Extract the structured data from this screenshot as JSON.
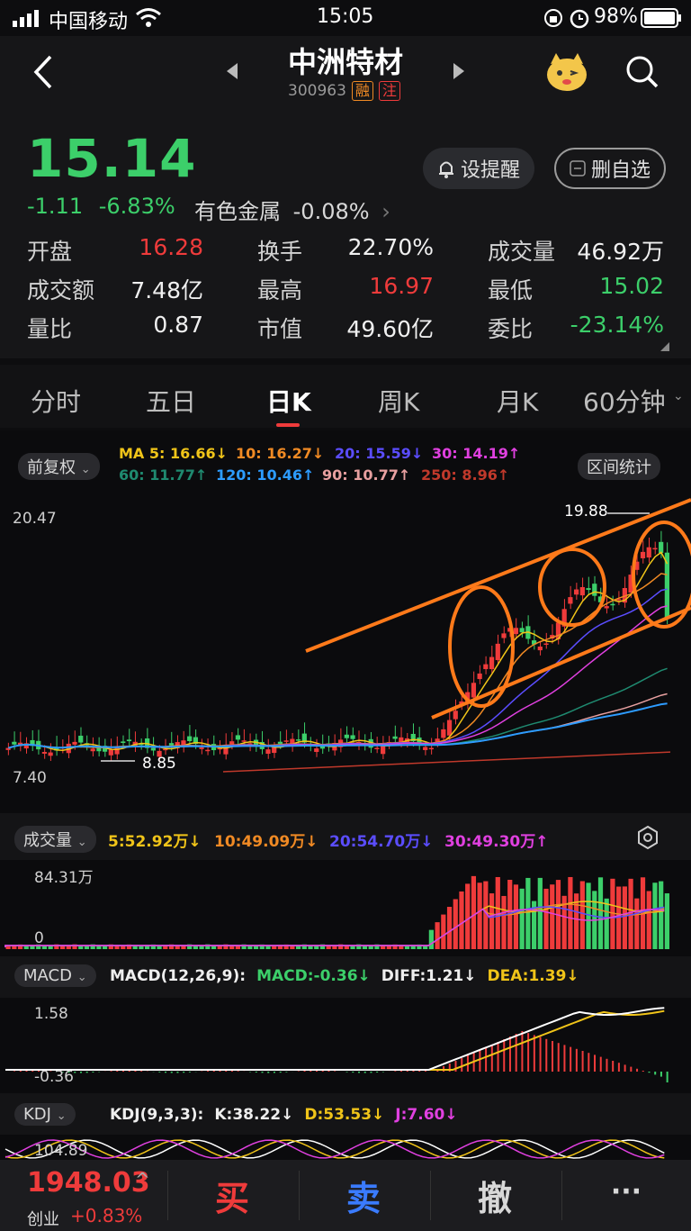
{
  "status_bar": {
    "carrier": "中国移动",
    "time": "15:05",
    "battery": "98%"
  },
  "header": {
    "name": "中洲特材",
    "code": "300963",
    "tag1": "融",
    "tag2": "注"
  },
  "quote": {
    "price": "15.14",
    "change": "-1.11",
    "change_pct": "-6.83%",
    "sector": "有色金属",
    "sector_pct": "-0.08%",
    "alert_label": "设提醒",
    "remove_label": "删自选",
    "stats": [
      {
        "label": "开盘",
        "value": "16.28",
        "color": "red"
      },
      {
        "label": "换手",
        "value": "22.70%",
        "color": "white"
      },
      {
        "label": "成交量",
        "value": "46.92万",
        "color": "white"
      },
      {
        "label": "成交额",
        "value": "7.48亿",
        "color": "white"
      },
      {
        "label": "最高",
        "value": "16.97",
        "color": "red"
      },
      {
        "label": "最低",
        "value": "15.02",
        "color": "green"
      },
      {
        "label": "量比",
        "value": "0.87",
        "color": "white"
      },
      {
        "label": "市值",
        "value": "49.60亿",
        "color": "white"
      },
      {
        "label": "委比",
        "value": "-23.14%",
        "color": "green"
      }
    ]
  },
  "tabs": [
    "分时",
    "五日",
    "日K",
    "周K",
    "月K",
    "60分钟"
  ],
  "active_tab": "日K",
  "kline": {
    "adjust_label": "前复权",
    "range_label": "区间统计",
    "ma": [
      {
        "label": "MA 5: 16.66↓",
        "color": "#f0c419"
      },
      {
        "label": "10: 16.27↓",
        "color": "#f08a24"
      },
      {
        "label": "20: 15.59↓",
        "color": "#5b4dff"
      },
      {
        "label": "30: 14.19↑",
        "color": "#e040e0"
      },
      {
        "label": "60: 11.77↑",
        "color": "#1f8a70"
      },
      {
        "label": "120: 10.46↑",
        "color": "#2d9cff"
      },
      {
        "label": "90: 10.77↑",
        "color": "#e8a0a0"
      },
      {
        "label": "250: 8.96↑",
        "color": "#c0392b"
      }
    ],
    "y_top": "20.47",
    "y_bottom": "7.40",
    "high_mark": "19.88",
    "low_mark": "8.85"
  },
  "volume": {
    "label": "成交量",
    "ma": [
      {
        "label": "5:52.92万↓",
        "color": "#f0c419"
      },
      {
        "label": "10:49.09万↓",
        "color": "#f08a24"
      },
      {
        "label": "20:54.70万↓",
        "color": "#5b4dff"
      },
      {
        "label": "30:49.30万↑",
        "color": "#e040e0"
      }
    ],
    "y_top": "84.31万",
    "y_bottom": "0"
  },
  "macd": {
    "label": "MACD",
    "params": "MACD(12,26,9):",
    "macd": "MACD:-0.36↓",
    "diff": "DIFF:1.21↓",
    "dea": "DEA:1.39↓",
    "y_top": "1.58",
    "y_bottom": "-0.36"
  },
  "kdj": {
    "label": "KDJ",
    "params": "KDJ(9,3,3):",
    "k": "K:38.22↓",
    "d": "D:53.53↓",
    "j": "J:7.60↓",
    "y_top": "104.89"
  },
  "bottom_bar": {
    "index_value": "1948.03",
    "index_name": "创业",
    "index_pct": "+0.83%",
    "buy": "买",
    "sell": "卖",
    "cancel": "撤",
    "more": "···"
  }
}
